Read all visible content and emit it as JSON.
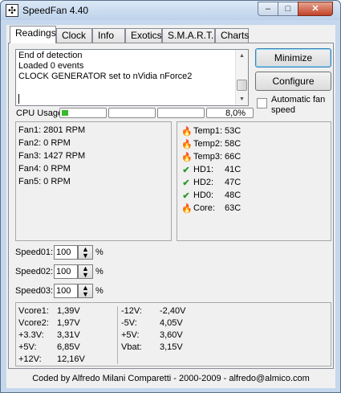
{
  "window": {
    "title": "SpeedFan 4.40",
    "minimize_glyph": "–",
    "maximize_glyph": "□",
    "close_glyph": "✕"
  },
  "tabs": [
    {
      "label": "Readings"
    },
    {
      "label": "Clock"
    },
    {
      "label": "Info"
    },
    {
      "label": "Exotics"
    },
    {
      "label": "S.M.A.R.T."
    },
    {
      "label": "Charts"
    }
  ],
  "log": {
    "lines": [
      "End of detection",
      "Loaded 0 events",
      "CLOCK GENERATOR set to nVidia nForce2"
    ]
  },
  "buttons": {
    "minimize": "Minimize",
    "configure": "Configure"
  },
  "auto_fan": {
    "label_line1": "Automatic fan",
    "label_line2": "speed",
    "checked": false
  },
  "cpu": {
    "label": "CPU Usage",
    "value_text": "8,0%",
    "bars": [
      0.16,
      0,
      0,
      0
    ]
  },
  "fans": [
    "Fan1: 2801 RPM",
    "Fan2: 0 RPM",
    "Fan3: 1427 RPM",
    "Fan4: 0 RPM",
    "Fan5: 0 RPM"
  ],
  "temps": [
    {
      "name": "Temp1:",
      "value": "53C",
      "icon": "flame-icon"
    },
    {
      "name": "Temp2:",
      "value": "58C",
      "icon": "flame-icon"
    },
    {
      "name": "Temp3:",
      "value": "66C",
      "icon": "flame-icon"
    },
    {
      "name": "HD1:",
      "value": "41C",
      "icon": "check-icon"
    },
    {
      "name": "HD2:",
      "value": "47C",
      "icon": "check-icon"
    },
    {
      "name": "HD0:",
      "value": "48C",
      "icon": "check-icon"
    },
    {
      "name": "Core:",
      "value": "63C",
      "icon": "flame-icon"
    }
  ],
  "speeds": [
    {
      "label": "Speed01:",
      "value": "100",
      "unit": "%"
    },
    {
      "label": "Speed02:",
      "value": "100",
      "unit": "%"
    },
    {
      "label": "Speed03:",
      "value": "100",
      "unit": "%"
    }
  ],
  "voltages_left": [
    {
      "label": "Vcore1:",
      "value": "1,39V"
    },
    {
      "label": "Vcore2:",
      "value": "1,97V"
    },
    {
      "label": "+3.3V:",
      "value": "3,31V"
    },
    {
      "label": "+5V:",
      "value": "6,85V"
    },
    {
      "label": "+12V:",
      "value": "12,16V"
    }
  ],
  "voltages_right": [
    {
      "label": "-12V:",
      "value": "-2,40V"
    },
    {
      "label": "-5V:",
      "value": "4,05V"
    },
    {
      "label": "+5V:",
      "value": "3,60V"
    },
    {
      "label": "Vbat:",
      "value": "3,15V"
    }
  ],
  "footer": "Coded by Alfredo Milani Comparetti - 2000-2009 - alfredo@almico.com",
  "colors": {
    "flame": "#e04a10",
    "check": "#2a9a2a",
    "cpu_fill": "#38b82c"
  }
}
